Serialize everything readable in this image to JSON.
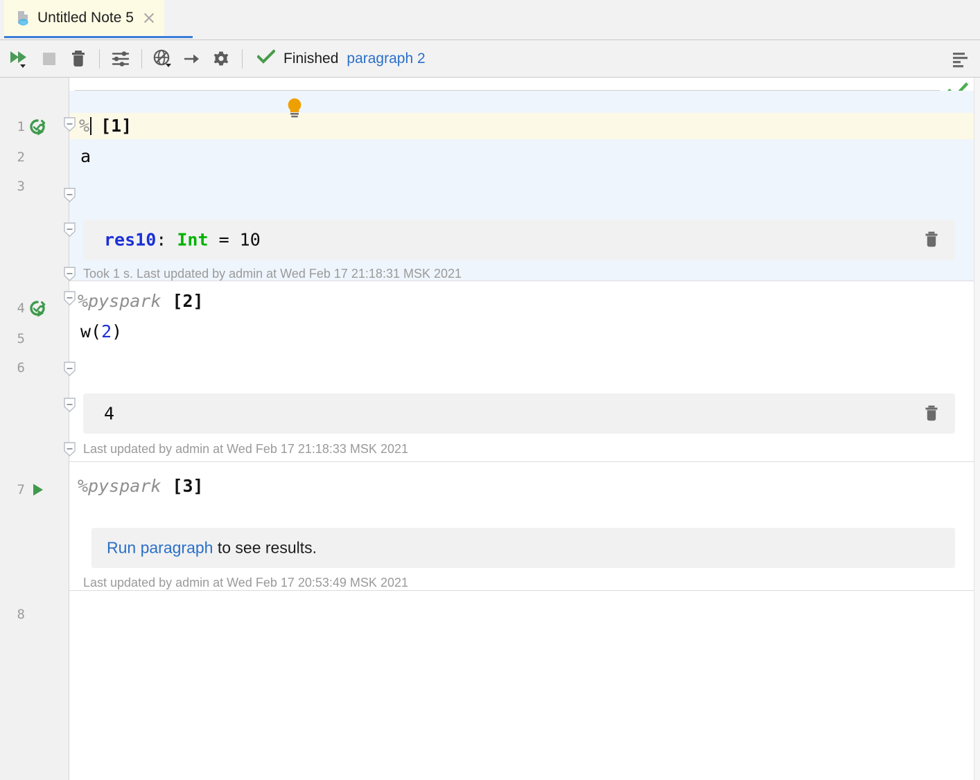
{
  "window": {
    "tab": {
      "title": "Untitled Note 5",
      "icon": "note-icon",
      "close_icon": "close-icon"
    }
  },
  "toolbar": {
    "buttons": [
      {
        "name": "run-all-button",
        "icon": "double-play-icon",
        "label": "Run all paragraphs"
      },
      {
        "name": "stop-button",
        "icon": "stop-square-icon",
        "label": "Stop"
      },
      {
        "name": "delete-button",
        "icon": "trash-icon",
        "label": "Delete"
      },
      {
        "name": "settings-sliders-button",
        "icon": "sliders-icon",
        "label": "Interpreter settings"
      },
      {
        "name": "interpreter-button",
        "icon": "globe-icon",
        "label": "Interpreter binding"
      },
      {
        "name": "arrow-button",
        "icon": "arrow-right-icon",
        "label": "Go to"
      },
      {
        "name": "gear-button",
        "icon": "gear-icon",
        "label": "Settings"
      }
    ],
    "status": {
      "icon": "check-icon",
      "text": "Finished",
      "link": "paragraph 2",
      "link_color": "#2a6fc9",
      "check_color": "#479a4a"
    },
    "right_button": {
      "name": "toggle-output-button",
      "icon": "align-lines-icon"
    }
  },
  "editor": {
    "line_numbers": [
      "1",
      "2",
      "3",
      "4",
      "5",
      "6",
      "7",
      "8"
    ],
    "inspection_icon": "green-check-icon",
    "bulb_icon": "lightbulb-icon",
    "paragraphs": [
      {
        "id": "paragraph-1",
        "gutter_icon": "run-success-icon",
        "magic": "%",
        "has_caret": true,
        "index": "[1]",
        "code_lines": [
          "a"
        ],
        "output": {
          "segments": [
            {
              "text": "res10",
              "style": "blue-bold"
            },
            {
              "text": ": ",
              "style": "plain"
            },
            {
              "text": "Int",
              "style": "green-bold"
            },
            {
              "text": " = 10",
              "style": "plain"
            }
          ],
          "plain": "res10: Int = 10",
          "delete_icon": "trash-icon"
        },
        "footer": "Took 1 s. Last updated by admin at Wed Feb 17 21:18:31 MSK 2021",
        "background": "#eff5fc"
      },
      {
        "id": "paragraph-2",
        "gutter_icon": "run-success-icon",
        "magic": "%pyspark",
        "has_caret": false,
        "index": "[2]",
        "code_lines": [
          "w(2)"
        ],
        "output": {
          "segments": [
            {
              "text": "4",
              "style": "plain"
            }
          ],
          "plain": "4",
          "delete_icon": "trash-icon"
        },
        "footer": "Last updated by admin at Wed Feb 17 21:18:33 MSK 2021",
        "background": "#ffffff"
      },
      {
        "id": "paragraph-3",
        "gutter_icon": "run-play-icon",
        "magic": "%pyspark",
        "has_caret": false,
        "index": "[3]",
        "code_lines": [],
        "run_hint": {
          "link": "Run paragraph",
          "rest": " to see results."
        },
        "footer": "Last updated by admin at Wed Feb 17 20:53:49 MSK 2021",
        "background": "#ffffff"
      }
    ]
  }
}
